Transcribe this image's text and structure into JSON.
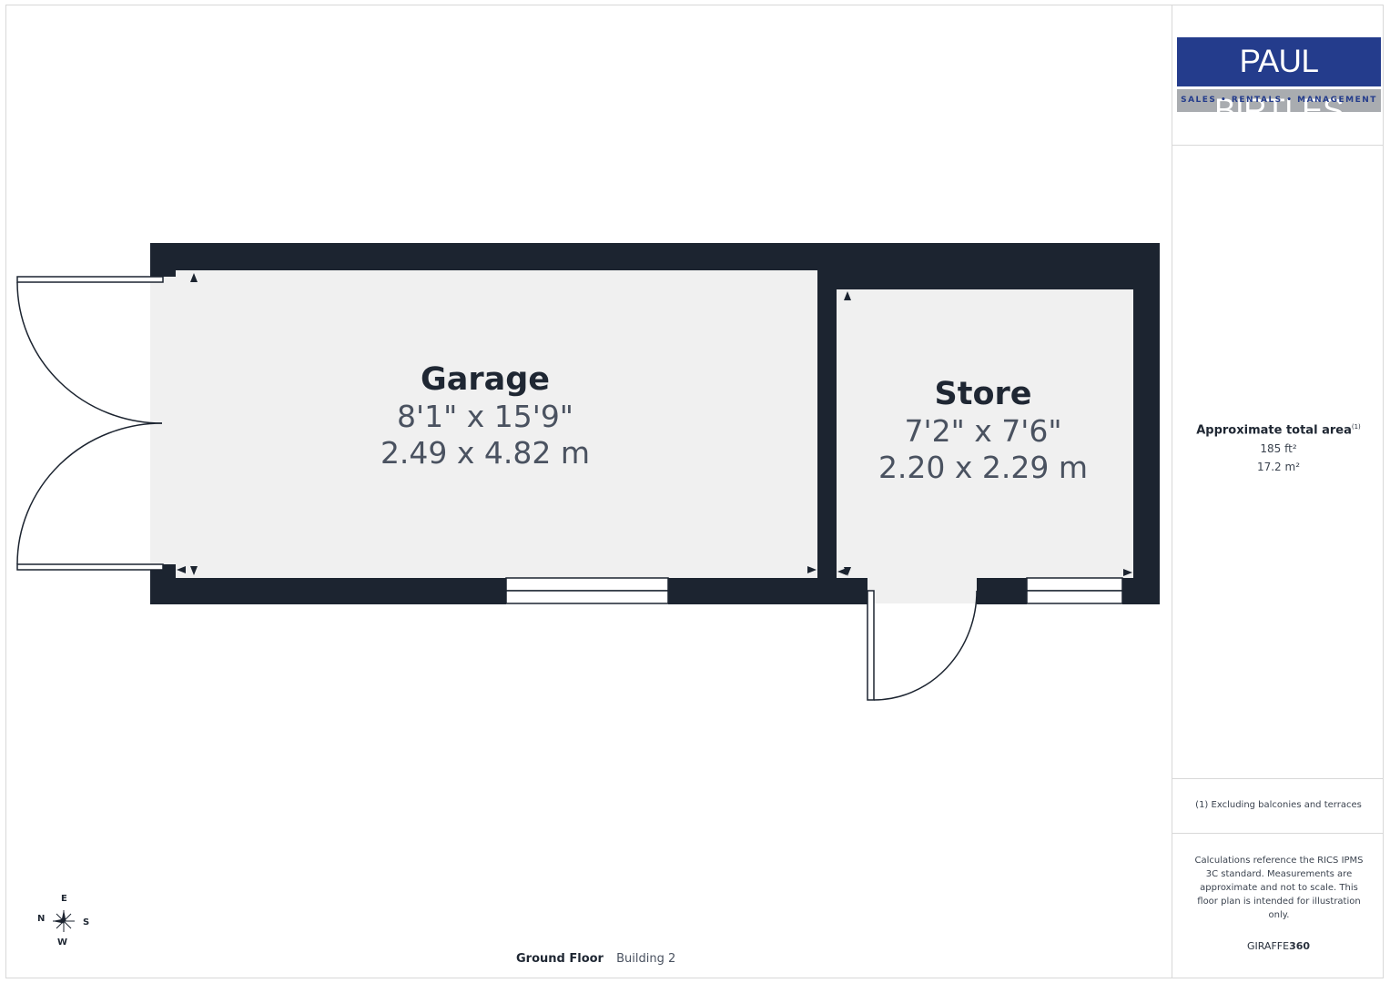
{
  "rooms": [
    {
      "name": "Garage",
      "dim_imperial": "8'1\" x 15'9\"",
      "dim_metric": "2.49 x 4.82 m"
    },
    {
      "name": "Store",
      "dim_imperial": "7'2\" x 7'6\"",
      "dim_metric": "2.20 x 2.29 m"
    }
  ],
  "logo": {
    "name": "PAUL BIRTLES",
    "tagline": "SALES • RENTALS • MANAGEMENT"
  },
  "area": {
    "title": "Approximate total area",
    "title_note": "(1)",
    "sqft": "185 ft²",
    "sqm": "17.2 m²"
  },
  "note": "(1) Excluding balconies and terraces",
  "calc_note": "Calculations reference the RICS IPMS 3C standard. Measurements are approximate and not to scale. This floor plan is intended for illustration only.",
  "brand": {
    "prefix": "GIRAFFE",
    "suffix": "360"
  },
  "footer": {
    "floor": "Ground Floor",
    "building": "Building 2"
  },
  "compass": {
    "n": "N",
    "e": "E",
    "s": "S",
    "w": "W"
  },
  "colors": {
    "wall": "#1c2430",
    "floor": "#f0f0f0",
    "logo_blue": "#243c8c",
    "logo_grey": "#a9acb0"
  }
}
